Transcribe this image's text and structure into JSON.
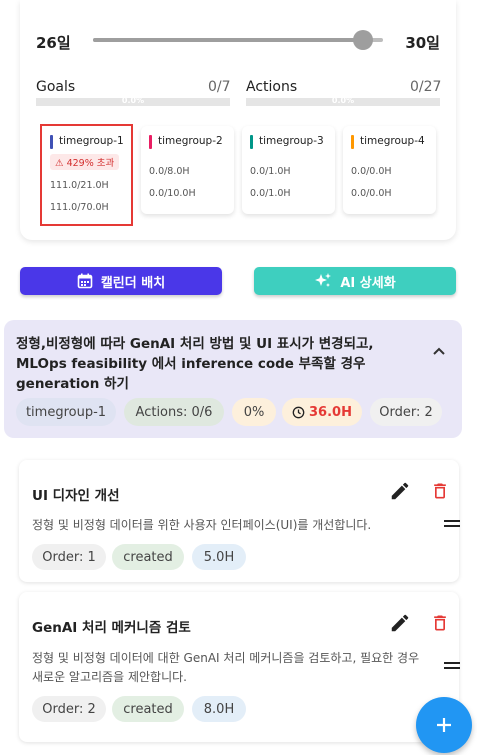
{
  "range": {
    "start_label": "26일",
    "end_label": "30일",
    "value": 0.93
  },
  "goals": {
    "label": "Goals",
    "count": "0/7",
    "bar_text": "0.0%"
  },
  "actions": {
    "label": "Actions",
    "count": "0/27",
    "bar_text": "0.0%"
  },
  "timegroups": [
    {
      "name": "timegroup-1",
      "color": "#3f51b5",
      "warning": "429% 초과",
      "values": [
        "111.0/21.0H",
        "111.0/70.0H"
      ]
    },
    {
      "name": "timegroup-2",
      "color": "#e91e63",
      "values": [
        "0.0/8.0H",
        "0.0/10.0H"
      ]
    },
    {
      "name": "timegroup-3",
      "color": "#009688",
      "values": [
        "0.0/1.0H",
        "0.0/1.0H"
      ]
    },
    {
      "name": "timegroup-4",
      "color": "#ff9800",
      "values": [
        "0.0/0.0H",
        "0.0/0.0H"
      ]
    }
  ],
  "buttons": {
    "calendar": "캘린더 배치",
    "ai": "AI 상세화"
  },
  "goal": {
    "title": "정형,비정형에 따라 GenAI 처리 방법 및 UI 표시가 변경되고, MLOps feasibility 에서 inference code 부족할 경우  generation 하기",
    "chips": {
      "timegroup": "timegroup-1",
      "actions": "Actions: 0/6",
      "percent": "0%",
      "hours": "36.0H",
      "order": "Order: 2"
    }
  },
  "tasks": [
    {
      "title": "UI 디자인 개선",
      "desc": "정형 및 비정형 데이터를 위한 사용자 인터페이스(UI)를 개선합니다.",
      "order": "Order: 1",
      "status": "created",
      "hours": "5.0H"
    },
    {
      "title": "GenAI 처리 메커니즘 검토",
      "desc": "정형 및 비정형 데이터에 대한 GenAI 처리 메커니즘을 검토하고, 필요한 경우 새로운 알고리즘을 제안합니다.",
      "order": "Order: 2",
      "status": "created",
      "hours": "8.0H"
    }
  ],
  "colors": {
    "primary": "#4a37e8",
    "teal": "#3ecfbf",
    "danger": "#e53935",
    "fab": "#2196f3"
  }
}
